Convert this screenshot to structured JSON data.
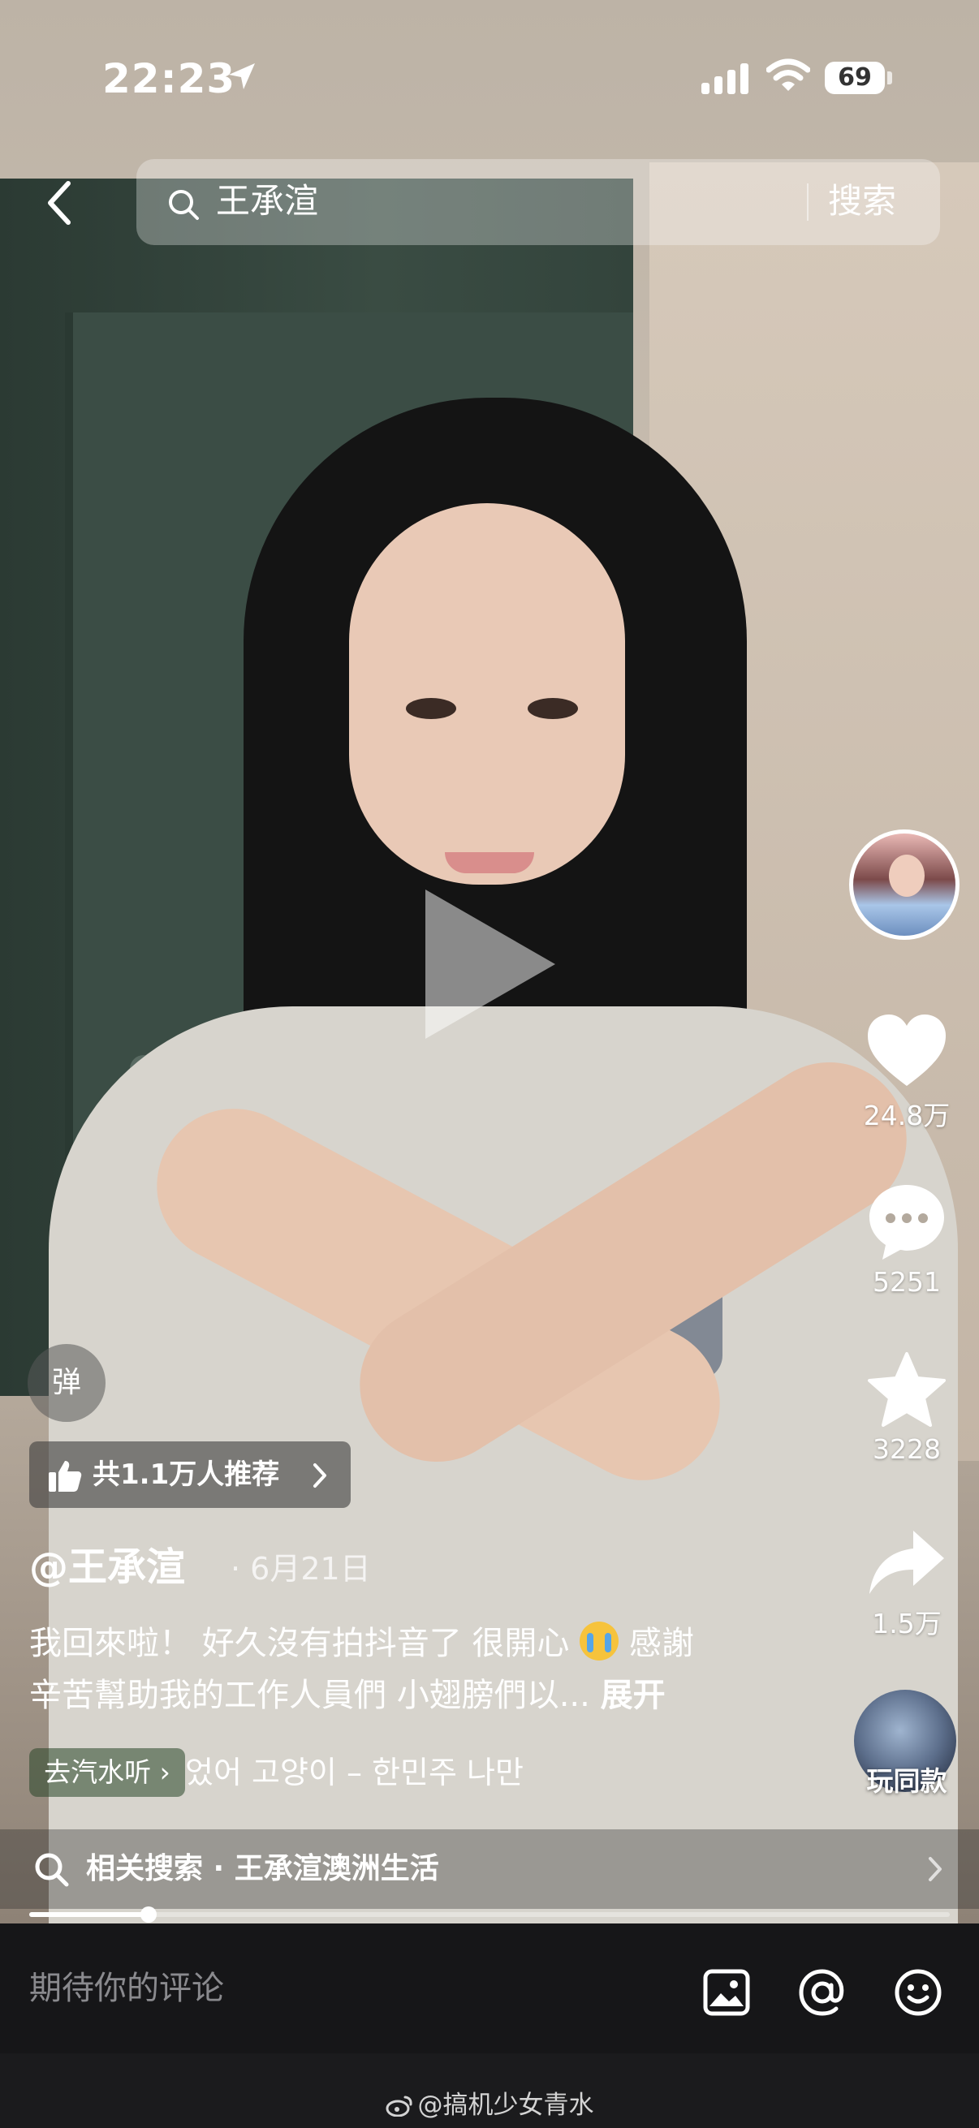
{
  "status_bar": {
    "time": "22:23",
    "battery": "69"
  },
  "search": {
    "query": "王承渲",
    "button_label": "搜索"
  },
  "video": {
    "danmu_label": "弹",
    "recommend": "共1.1万人推荐",
    "author": "@王承渲",
    "date": "6月21日",
    "caption_line1_a": "我回來啦！ 好久沒有拍抖音了 很開心",
    "caption_line1_b": " 感謝",
    "caption_line2": "辛苦幫助我的工作人員們 小翅膀們以... ",
    "expand_label": "展开",
    "music_tag": "去汽水听",
    "music_title": "었어 고양이 – 한민주  나만",
    "progress": 0.13
  },
  "rail": {
    "likes": "24.8万",
    "comments": "5251",
    "favorites": "3228",
    "shares": "1.5万",
    "same_style": "玩同款"
  },
  "related_search": {
    "label": "相关搜索 · 王承渲澳洲生活"
  },
  "comment_bar": {
    "placeholder": "期待你的评论"
  },
  "watermark": {
    "text": "@搞机少女青水"
  },
  "icons": [
    "location-arrow-icon",
    "signal-icon",
    "wifi-icon",
    "back-arrow-icon",
    "search-icon",
    "heart-icon",
    "comment-icon",
    "star-icon",
    "share-icon",
    "thumbs-up-icon",
    "chevron-right-icon",
    "image-icon",
    "at-icon",
    "emoji-icon",
    "weibo-icon"
  ]
}
